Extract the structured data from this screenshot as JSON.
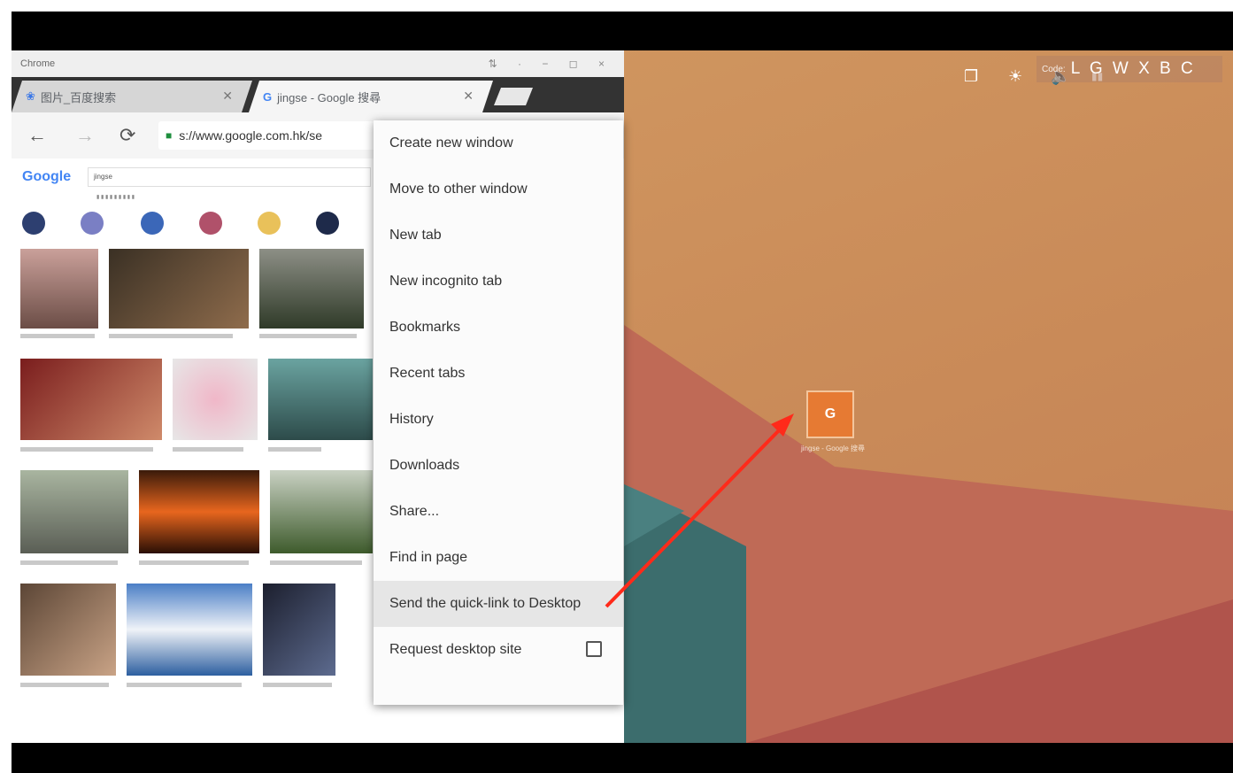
{
  "window": {
    "app_title": "Chrome",
    "window_controls": "⇅ · − ◻ ×"
  },
  "tabs": [
    {
      "label": "图片_百度搜索",
      "icon": "baidu-paw-icon"
    },
    {
      "label": "jingse - Google 搜尋",
      "icon": "google-g-icon"
    }
  ],
  "omnibox": {
    "url": "s://www.google.com.hk/se"
  },
  "google_page": {
    "logo": "Google",
    "query": "jingse"
  },
  "menu": {
    "items": [
      {
        "label": "Create new window"
      },
      {
        "label": "Move to other window"
      },
      {
        "label": "New tab"
      },
      {
        "label": "New incognito tab"
      },
      {
        "label": "Bookmarks"
      },
      {
        "label": "Recent tabs"
      },
      {
        "label": "History"
      },
      {
        "label": "Downloads"
      },
      {
        "label": "Share..."
      },
      {
        "label": "Find in page"
      },
      {
        "label": "Send the quick-link to Desktop",
        "highlighted": true
      },
      {
        "label": "Request desktop site",
        "checkbox": true,
        "checked": false
      }
    ]
  },
  "desktop": {
    "shortcut_letter": "G",
    "code_prefix": "Code:",
    "code_value": "L G W X B C"
  },
  "colors": {
    "wallpaper_orange": "#d29a62",
    "wallpaper_red": "#b65d4f",
    "wallpaper_teal": "#3b6e6e",
    "shortcut_orange": "#e67a33",
    "annotation_arrow": "#ff2a1a"
  }
}
